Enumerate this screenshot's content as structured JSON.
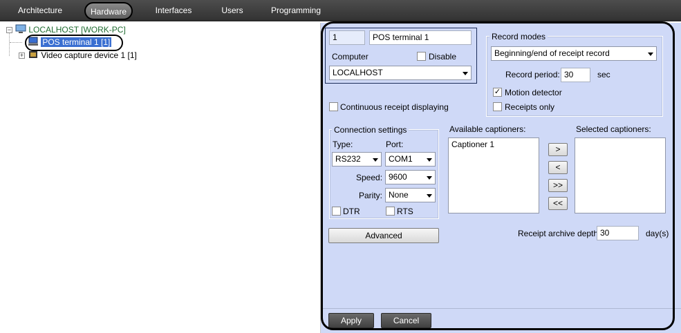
{
  "tabs": [
    "Architecture",
    "Hardware",
    "Interfaces",
    "Users",
    "Programming"
  ],
  "active_tab": "Hardware",
  "tree": {
    "root": "LOCALHOST [WORK-PC]",
    "selected": "POS terminal 1 [1]",
    "child2": "Video capture device 1 [1]"
  },
  "form": {
    "id_value": "1",
    "name_value": "POS terminal 1",
    "computer_label": "Computer",
    "disable_label": "Disable",
    "computer_value": "LOCALHOST",
    "continuous_label": "Continuous receipt displaying",
    "record_modes": {
      "title": "Record modes",
      "mode_value": "Beginning/end of receipt record",
      "period_label": "Record period:",
      "period_value": "30",
      "period_unit": "sec",
      "motion_label": "Motion detector",
      "receipts_only_label": "Receipts only"
    },
    "connection": {
      "title": "Connection settings",
      "type_label": "Type:",
      "port_label": "Port:",
      "type_value": "RS232",
      "port_value": "COM1",
      "speed_label": "Speed:",
      "speed_value": "9600",
      "parity_label": "Parity:",
      "parity_value": "None",
      "dtr_label": "DTR",
      "rts_label": "RTS"
    },
    "available_label": "Available captioners:",
    "selected_label": "Selected captioners:",
    "available_items": [
      "Captioner 1"
    ],
    "move_buttons": [
      ">",
      "<",
      ">>",
      "<<"
    ],
    "advanced_label": "Advanced",
    "archive_label": "Receipt archive depth:",
    "archive_value": "30",
    "archive_unit": "day(s)"
  },
  "buttons": {
    "apply": "Apply",
    "cancel": "Cancel"
  },
  "colors": {
    "panel_bg": "#cfd9f7",
    "tabbar_bg": "#3d3d3d",
    "tree_link": "#1e6b2f",
    "selection": "#3a6fd1"
  }
}
